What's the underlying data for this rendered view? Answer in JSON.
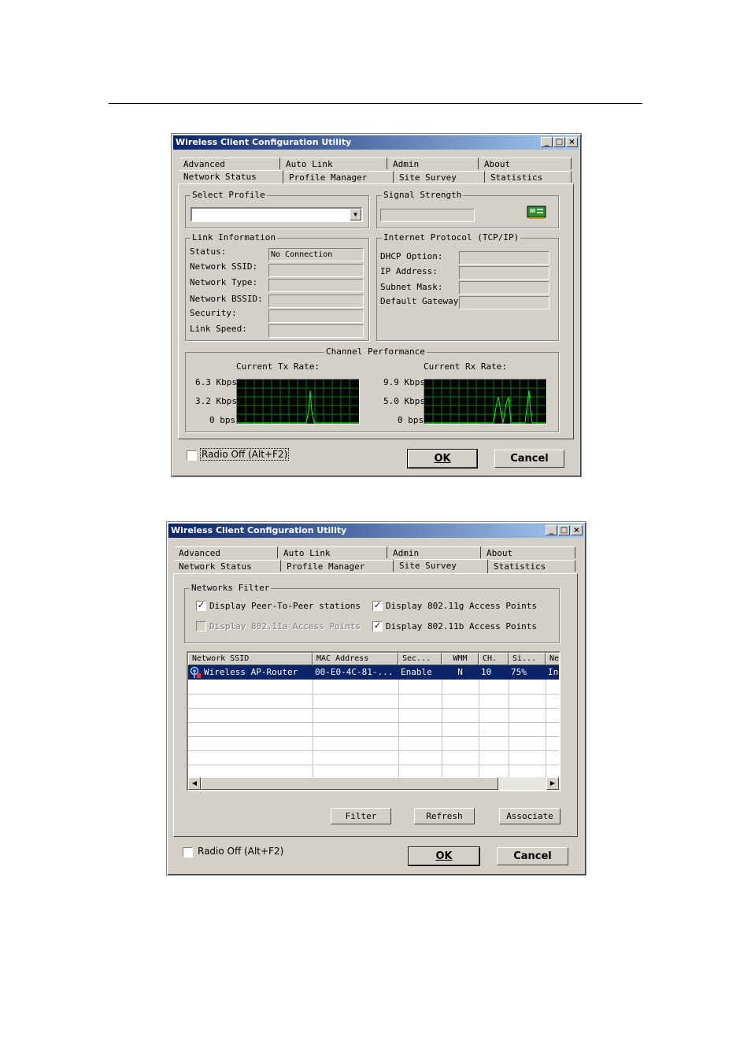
{
  "window1": {
    "title": "Wireless Client Configuration Utility",
    "tabs_back": [
      "Advanced",
      "Auto Link",
      "Admin",
      "About"
    ],
    "tabs_front": [
      "Network Status",
      "Profile Manager",
      "Site Survey",
      "Statistics"
    ],
    "active_tab": "Network Status",
    "select_profile": {
      "label": "Select Profile",
      "value": ""
    },
    "signal_strength": {
      "label": "Signal Strength",
      "icon": "network-card-icon"
    },
    "link_info": {
      "label": "Link Information",
      "rows": [
        {
          "label": "Status:",
          "value": "No Connection"
        },
        {
          "label": "Network SSID:",
          "value": ""
        },
        {
          "label": "Network Type:",
          "value": ""
        },
        {
          "label": "Network BSSID:",
          "value": ""
        },
        {
          "label": "Security:",
          "value": ""
        },
        {
          "label": "Link Speed:",
          "value": ""
        }
      ]
    },
    "tcpip": {
      "label": "Internet Protocol (TCP/IP)",
      "rows": [
        {
          "label": "DHCP Option:",
          "value": ""
        },
        {
          "label": "IP Address:",
          "value": ""
        },
        {
          "label": "Subnet Mask:",
          "value": ""
        },
        {
          "label": "Default Gateway:",
          "value": ""
        }
      ]
    },
    "channel": {
      "label": "Channel Performance",
      "tx": {
        "label": "Current Tx Rate:",
        "ticks": [
          "6.3 Kbps",
          "3.2 Kbps",
          "0 bps"
        ]
      },
      "rx": {
        "label": "Current Rx Rate:",
        "ticks": [
          "9.9 Kbps",
          "5.0 Kbps",
          "0 bps"
        ]
      }
    },
    "radio_off": {
      "label": "Radio Off (Alt+F2)",
      "checked": false
    },
    "ok": "OK",
    "cancel": "Cancel"
  },
  "window2": {
    "title": "Wireless Client Configuration Utility",
    "tabs_back": [
      "Advanced",
      "Auto Link",
      "Admin",
      "About"
    ],
    "tabs_front": [
      "Network Status",
      "Profile Manager",
      "Site Survey",
      "Statistics"
    ],
    "active_tab": "Site Survey",
    "filter": {
      "label": "Networks Filter",
      "options": [
        {
          "label": "Display Peer-To-Peer stations",
          "checked": true,
          "enabled": true
        },
        {
          "label": "Display 802.11g Access Points",
          "checked": true,
          "enabled": true
        },
        {
          "label": "Display 802.11a Access Points",
          "checked": false,
          "enabled": false
        },
        {
          "label": "Display 802.11b Access Points",
          "checked": true,
          "enabled": true
        }
      ]
    },
    "table": {
      "columns": [
        "Network SSID",
        "MAC Address",
        "Sec...",
        "WMM",
        "CH.",
        "Si...",
        "Ne"
      ],
      "rows": [
        {
          "ssid": "Wireless AP-Router",
          "mac": "00-E0-4C-81-...",
          "sec": "Enable",
          "wmm": "N",
          "ch": "10",
          "signal": "75%",
          "net": "In"
        }
      ]
    },
    "buttons": {
      "filter": "Filter",
      "refresh": "Refresh",
      "associate": "Associate"
    },
    "radio_off": {
      "label": "Radio Off (Alt+F2)",
      "checked": false
    },
    "ok": "OK",
    "cancel": "Cancel"
  }
}
